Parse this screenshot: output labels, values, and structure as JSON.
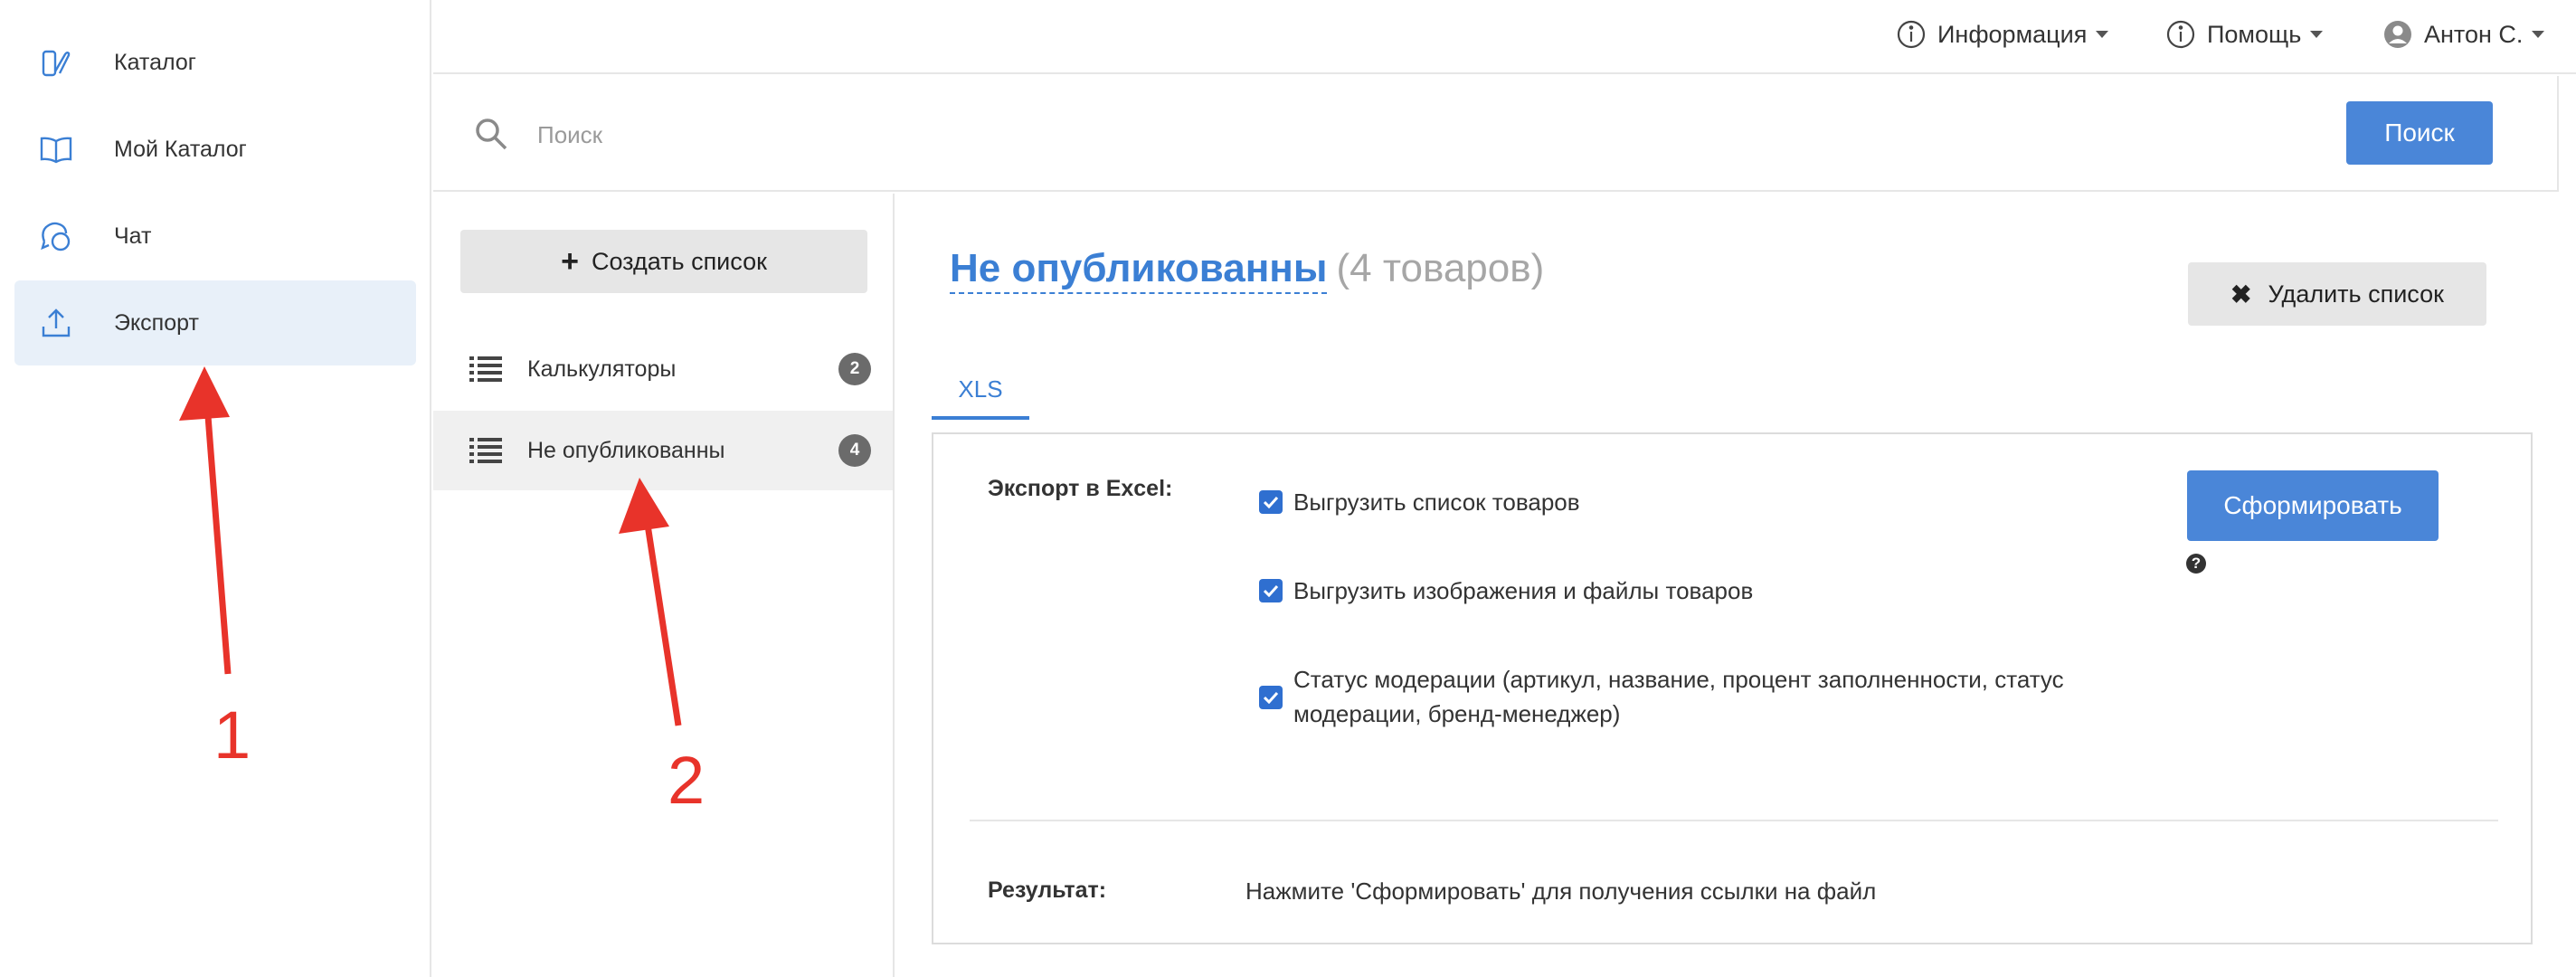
{
  "nav": {
    "items": [
      {
        "label": "Каталог",
        "icon": "catalog-icon"
      },
      {
        "label": "Мой Каталог",
        "icon": "book-icon"
      },
      {
        "label": "Чат",
        "icon": "chat-icon"
      },
      {
        "label": "Экспорт",
        "icon": "upload-icon",
        "active": true
      }
    ]
  },
  "header": {
    "info_label": "Информация",
    "help_label": "Помощь",
    "user_label": "Антон С."
  },
  "search": {
    "placeholder": "Поиск",
    "value": "",
    "button_label": "Поиск"
  },
  "lists": {
    "create_label": "Создать список",
    "items": [
      {
        "label": "Калькуляторы",
        "count": "2"
      },
      {
        "label": "Не опубликованны",
        "count": "4",
        "active": true
      }
    ]
  },
  "main": {
    "title": "Не опубликованны",
    "count_text": "(4 товаров)",
    "delete_label": "Удалить список",
    "tab_label": "XLS",
    "export_label": "Экспорт в Excel:",
    "options": [
      {
        "label": "Выгрузить список товаров",
        "checked": true
      },
      {
        "label": "Выгрузить изображения и файлы товаров",
        "checked": true
      },
      {
        "label_line1": "Статус модерации (артикул, название, процент заполненности, статус",
        "label_line2": "модерации, бренд-менеджер)",
        "checked": true
      }
    ],
    "form_button_label": "Сформировать",
    "help_glyph": "?",
    "result_label": "Результат:",
    "result_text": "Нажмите 'Сформировать' для получения ссылки на файл"
  },
  "annotations": {
    "marker1": "1",
    "marker2": "2"
  },
  "colors": {
    "accent": "#4a86d8",
    "active_nav_bg": "#e8f0f9",
    "annotation_red": "#e8332a"
  }
}
